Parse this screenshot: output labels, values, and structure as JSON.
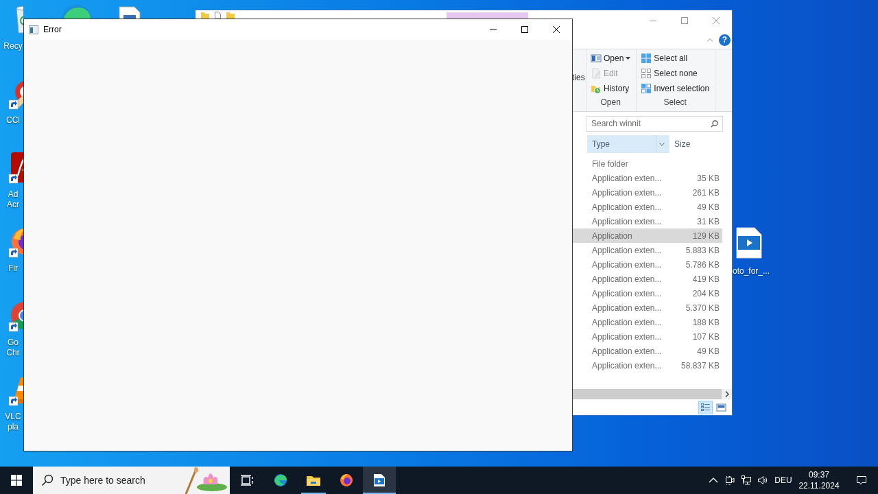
{
  "desktop": {
    "left_icons": [
      {
        "kind": "recycle-bin",
        "shortcut": false,
        "label": "Recy"
      },
      {
        "kind": "ccleaner",
        "shortcut": true,
        "label": "CCl"
      },
      {
        "kind": "acrobat",
        "shortcut": true,
        "label": "Ad Acr"
      },
      {
        "kind": "firefox",
        "shortcut": true,
        "label": "Fir"
      },
      {
        "kind": "chrome",
        "shortcut": true,
        "label": "Go Chr"
      },
      {
        "kind": "vlc",
        "shortcut": true,
        "label": "VLC pla"
      }
    ],
    "top_icons": [
      {
        "kind": "edge"
      },
      {
        "kind": "document"
      }
    ],
    "right_icons": [
      {
        "kind": "video-file",
        "label": "oto_for_..."
      }
    ]
  },
  "explorer": {
    "help_glyph": "?",
    "ribbon": {
      "properties_fragment": "ties",
      "groups": [
        {
          "label": "Open",
          "items": [
            {
              "kind": "open",
              "label": "Open",
              "dropdown": true,
              "disabled": false
            },
            {
              "kind": "edit",
              "label": "Edit",
              "dropdown": false,
              "disabled": true
            },
            {
              "kind": "history",
              "label": "History",
              "dropdown": false,
              "disabled": false
            }
          ]
        },
        {
          "label": "Select",
          "items": [
            {
              "kind": "select-all",
              "label": "Select all",
              "dropdown": false,
              "disabled": false
            },
            {
              "kind": "select-none",
              "label": "Select none",
              "dropdown": false,
              "disabled": false
            },
            {
              "kind": "invert",
              "label": "Invert selection",
              "dropdown": false,
              "disabled": false
            }
          ]
        }
      ]
    },
    "search": {
      "placeholder": "Search winnit"
    },
    "columns": [
      {
        "label": "Type",
        "selected": true
      },
      {
        "label": "Size",
        "selected": false
      }
    ],
    "rows": [
      {
        "type": "File folder",
        "selected": false
      },
      {
        "type": "Application exten...",
        "size": "35 KB",
        "selected": false
      },
      {
        "type": "Application exten...",
        "size": "261 KB",
        "selected": false
      },
      {
        "type": "Application exten...",
        "size": "49 KB",
        "selected": false
      },
      {
        "type": "Application exten...",
        "size": "31 KB",
        "selected": false
      },
      {
        "type": "Application",
        "size": "129 KB",
        "selected": true
      },
      {
        "type": "Application exten...",
        "size": "5.883 KB",
        "selected": false
      },
      {
        "type": "Application exten...",
        "size": "5.786 KB",
        "selected": false
      },
      {
        "type": "Application exten...",
        "size": "419 KB",
        "selected": false
      },
      {
        "type": "Application exten...",
        "size": "204 KB",
        "selected": false
      },
      {
        "type": "Application exten...",
        "size": "5.370 KB",
        "selected": false
      },
      {
        "type": "Application exten...",
        "size": "188 KB",
        "selected": false
      },
      {
        "type": "Application exten...",
        "size": "107 KB",
        "selected": false
      },
      {
        "type": "Application exten...",
        "size": "49 KB",
        "selected": false
      },
      {
        "type": "Application exten...",
        "size": "58.837 KB",
        "selected": false
      }
    ],
    "views": [
      {
        "kind": "details",
        "selected": true
      },
      {
        "kind": "large-icons",
        "selected": false
      }
    ]
  },
  "error_window": {
    "title": "Error"
  },
  "taskbar": {
    "search": {
      "placeholder": "Type here to search"
    },
    "apps": [
      {
        "kind": "task-view",
        "running": false,
        "selected": false
      },
      {
        "kind": "edge",
        "running": false,
        "selected": false
      },
      {
        "kind": "file-explorer",
        "running": true,
        "selected": false
      },
      {
        "kind": "firefox",
        "running": false,
        "selected": false
      },
      {
        "kind": "media-app",
        "running": true,
        "selected": true
      }
    ],
    "tray": {
      "language": "DEU",
      "time": "09:37",
      "date": "22.11.2024"
    }
  }
}
